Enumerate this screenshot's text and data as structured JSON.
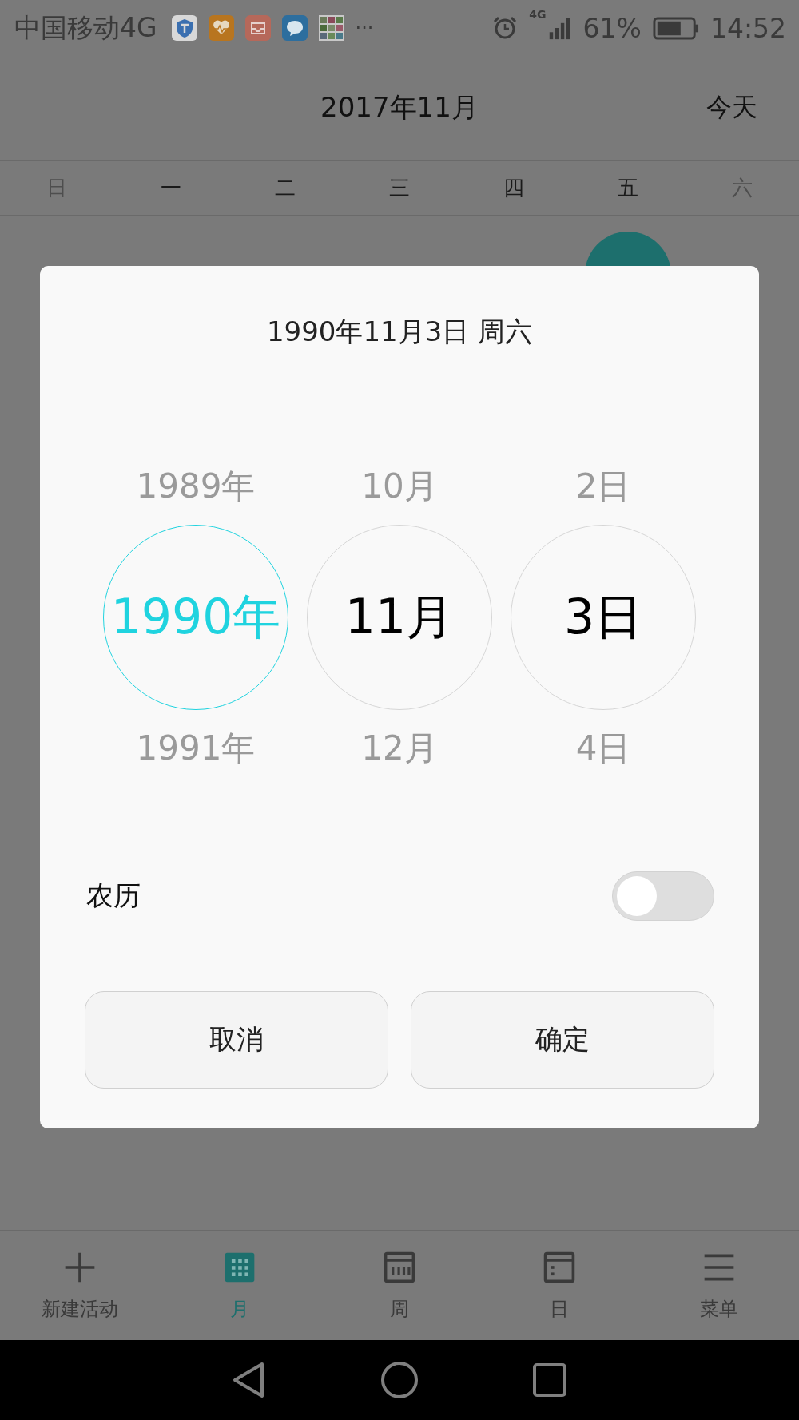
{
  "status_bar": {
    "carrier": "中国移动4G",
    "more": "···",
    "network": "4G",
    "battery": "61%",
    "time": "14:52"
  },
  "header": {
    "title": "2017年11月",
    "today_button": "今天"
  },
  "weekdays": [
    {
      "label": "日",
      "weekend": true
    },
    {
      "label": "一",
      "weekend": false
    },
    {
      "label": "二",
      "weekend": false
    },
    {
      "label": "三",
      "weekend": false
    },
    {
      "label": "四",
      "weekend": false
    },
    {
      "label": "五",
      "weekend": false
    },
    {
      "label": "六",
      "weekend": true
    }
  ],
  "dialog": {
    "title": "1990年11月3日 周六",
    "wheels": [
      {
        "previous": "1989年",
        "current": "1990年",
        "next": "1991年",
        "selected": true
      },
      {
        "previous": "10月",
        "current": "11月",
        "next": "12月",
        "selected": false
      },
      {
        "previous": "2日",
        "current": "3日",
        "next": "4日",
        "selected": false
      }
    ],
    "lunar": {
      "label": "农历",
      "on": false
    },
    "buttons": [
      "取消",
      "确定"
    ]
  },
  "bottom_nav": [
    {
      "kind": "add",
      "label": "新建活动",
      "selected": false
    },
    {
      "kind": "month",
      "label": "月",
      "selected": true
    },
    {
      "kind": "week",
      "label": "周",
      "selected": false
    },
    {
      "kind": "day",
      "label": "日",
      "selected": false
    },
    {
      "kind": "menu",
      "label": "菜单",
      "selected": false
    }
  ]
}
